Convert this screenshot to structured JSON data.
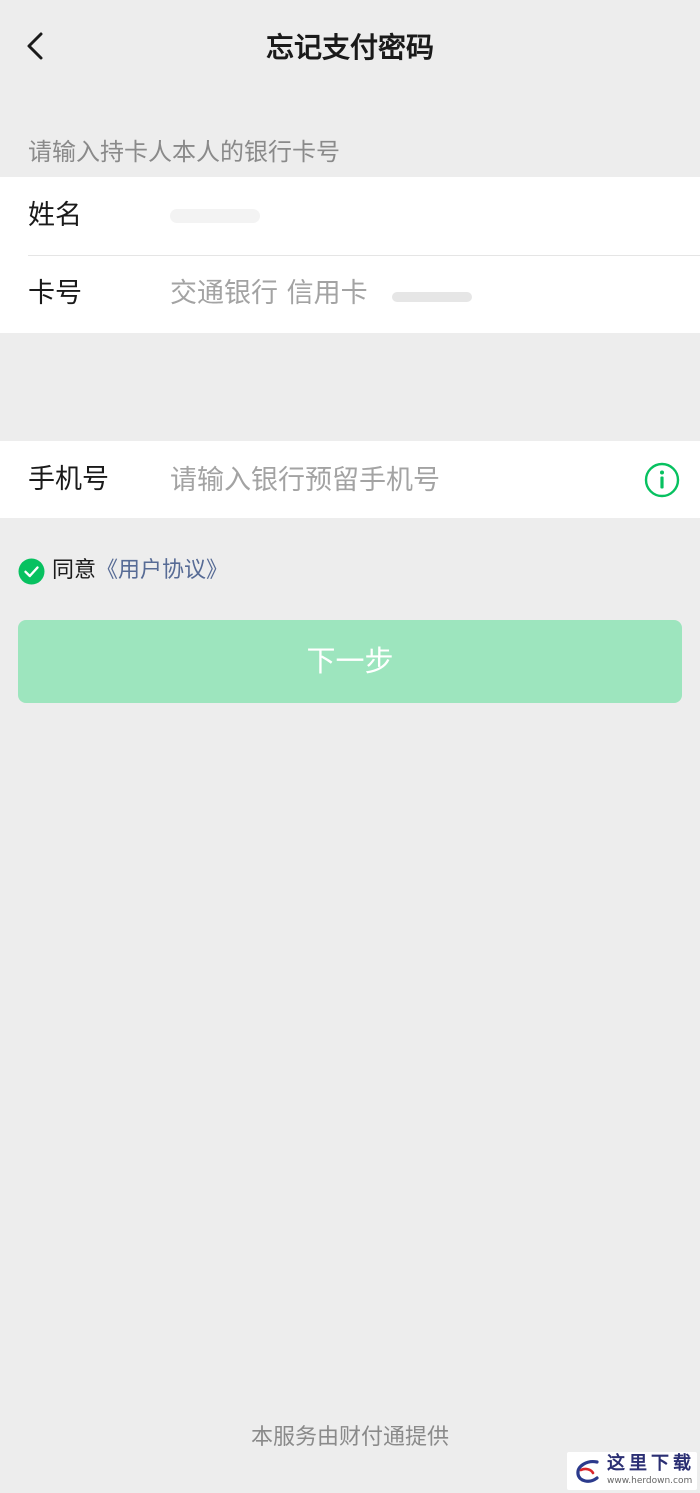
{
  "nav": {
    "back_icon": "chevron-left-icon",
    "title": "忘记支付密码"
  },
  "hint": "请输入持卡人本人的银行卡号",
  "card_group": {
    "name_label": "姓名",
    "card_label": "卡号",
    "card_value": "交通银行 信用卡"
  },
  "phone_group": {
    "label": "手机号",
    "placeholder": "请输入银行预留手机号",
    "info_icon": "info-circle-icon"
  },
  "agreement": {
    "checked": true,
    "prefix": "同意",
    "link": "《用户协议》"
  },
  "next_button": {
    "label": "下一步"
  },
  "footer": "本服务由财付通提供",
  "watermark": {
    "title": "这里下载",
    "url": "www.herdown.com"
  },
  "colors": {
    "background": "#ededed",
    "accent_green": "#07c160",
    "button_disabled": "#9de5be",
    "link": "#576b95"
  }
}
